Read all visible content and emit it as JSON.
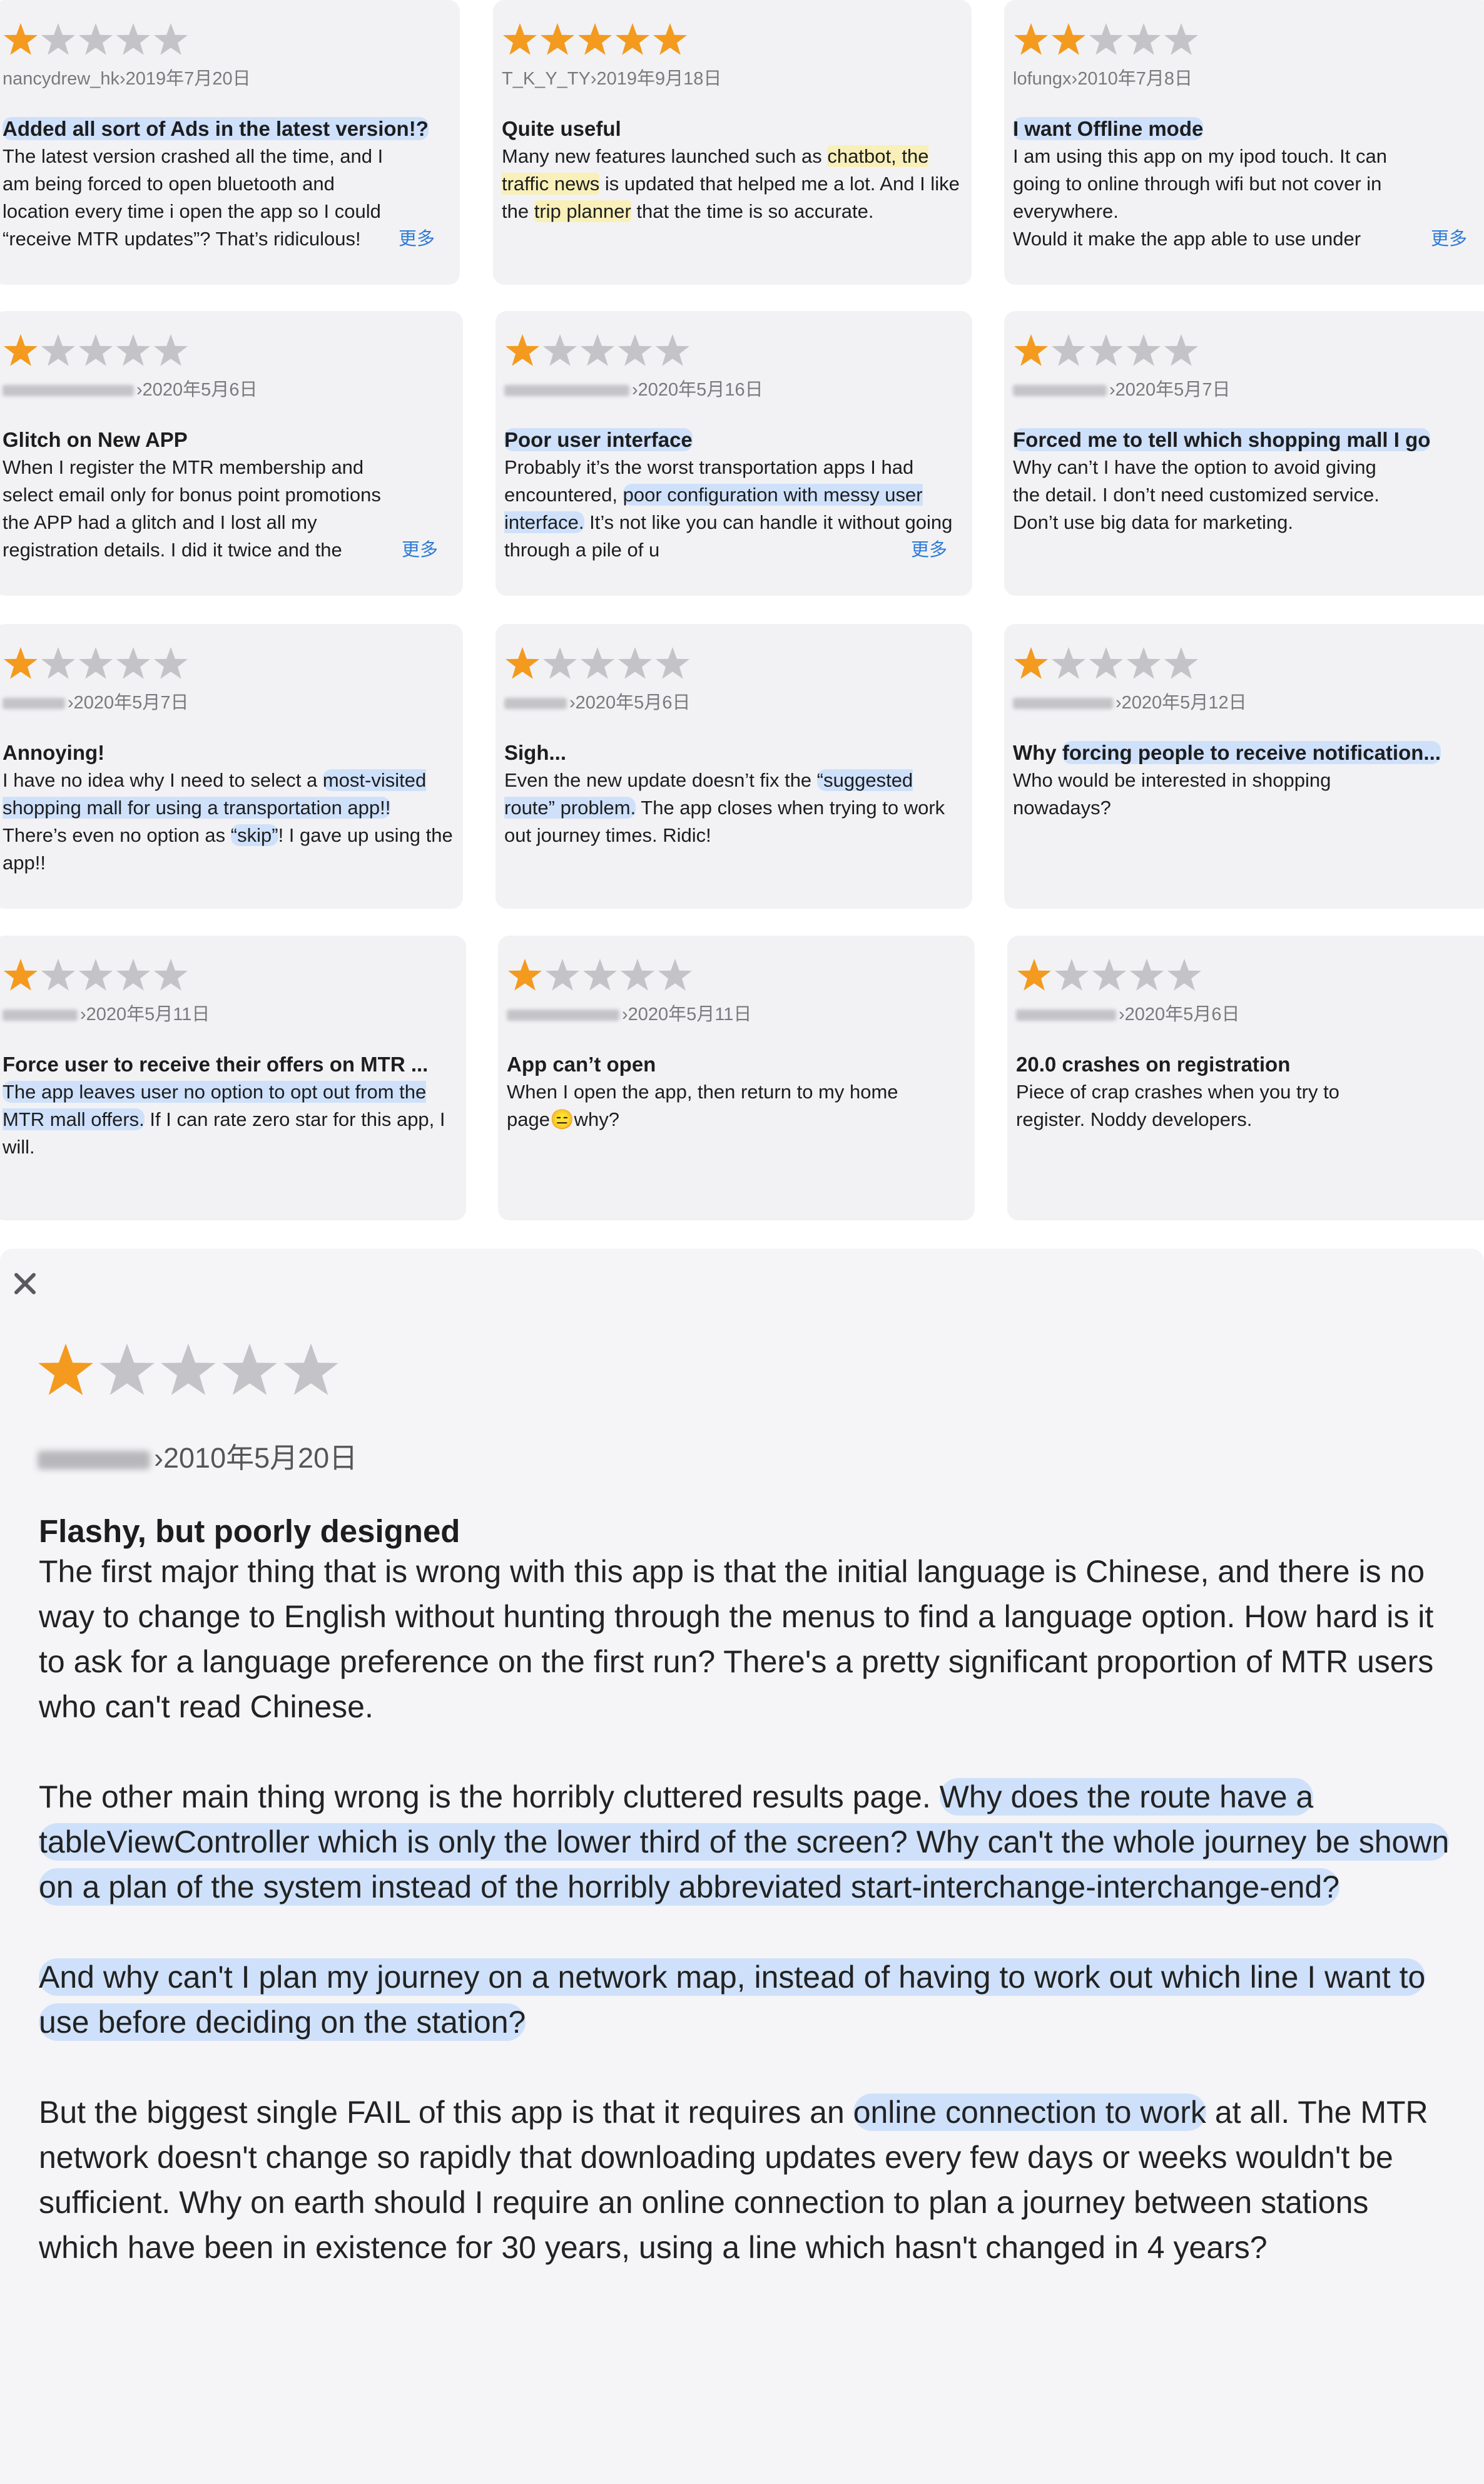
{
  "colors": {
    "star_filled": "#f39a1f",
    "star_empty": "#c4c4c8",
    "more_link": "#2f7bd6",
    "highlight_blue": "#cfe1fa",
    "highlight_yellow": "#f8f0b8"
  },
  "more_label": "更多",
  "reviews": [
    {
      "rating": 1,
      "author": "nancydrew_hk",
      "date": "2019年7月20日",
      "title": "Added all sort of Ads in the latest version!?",
      "body_lines": [
        "The latest version crashed all the time, and I",
        "am being forced to open bluetooth and",
        "location every time i open the app so I could",
        "“receive MTR updates”? That’s ridiculous!"
      ]
    },
    {
      "rating": 5,
      "author": "T_K_Y_TY",
      "date": "2019年9月18日",
      "title": "Quite useful",
      "body_parts": [
        "Many new features launched such as ",
        "chatbot, the traffic news",
        " is updated that helped me a lot. And I like the ",
        "trip planner",
        " that the time is so accurate."
      ]
    },
    {
      "rating": 2,
      "author": "lofungx",
      "date": "2010年7月8日",
      "title": "I want Offline mode",
      "body_lines": [
        "I am using this app on my ipod touch. It can",
        "going to online through wifi but not cover in",
        "everywhere.",
        "Would it make the app able to use under"
      ]
    },
    {
      "rating": 1,
      "author": "",
      "date": "2020年5月6日",
      "title": "Glitch on New APP",
      "body_lines": [
        "When I register the MTR membership and",
        "select email only for bonus point promotions",
        "the APP had a glitch and I lost all my",
        "registration details. I did it twice and the"
      ]
    },
    {
      "rating": 1,
      "author": "",
      "date": "2020年5月16日",
      "title": "Poor user interface",
      "body_parts": [
        "Probably it’s the worst transportation apps I had encountered, ",
        "poor configuration with messy user interface.",
        " It’s not like you can handle it without going through a pile of u"
      ]
    },
    {
      "rating": 1,
      "author": "",
      "date": "2020年5月7日",
      "title": "Forced me to tell which shopping mall I go",
      "body_lines": [
        "Why can’t I have the option to avoid giving",
        "the detail. I don’t need customized service.",
        "Don’t use big data for marketing."
      ]
    },
    {
      "rating": 1,
      "author": "",
      "date": "2020年5月7日",
      "title": "Annoying!",
      "body_parts": [
        "I have no idea why I need to select a ",
        "most-visited shopping mall for using a transportation app!!",
        " There’s even no option as ",
        "“skip”",
        "! I gave up using the app!!"
      ]
    },
    {
      "rating": 1,
      "author": "",
      "date": "2020年5月6日",
      "title": "Sigh...",
      "body_parts": [
        "Even the new update doesn’t fix the ",
        "“suggested route” problem.",
        " The app closes when trying to work out journey times. Ridic!"
      ]
    },
    {
      "rating": 1,
      "author": "",
      "date": "2020年5月12日",
      "title_parts": [
        "Why ",
        "forcing people to receive notification..."
      ],
      "body_lines": [
        "Who would be interested in shopping",
        "nowadays?"
      ]
    },
    {
      "rating": 1,
      "author": "",
      "date": "2020年5月11日",
      "title": "Force user to receive their offers on MTR ...",
      "body_parts": [
        "The app leaves user no option to opt out from the MTR mall offers.",
        " If I can rate zero star for this app, I will."
      ]
    },
    {
      "rating": 1,
      "author": "",
      "date": "2020年5月11日",
      "title": "App can’t open",
      "body_lines": [
        "When I open the app, then return to my home",
        "page😑why?"
      ]
    },
    {
      "rating": 1,
      "author": "",
      "date": "2020年5月6日",
      "title": "20.0 crashes on registration",
      "body_lines": [
        "Piece of crap crashes when you try to",
        "register. Noddy developers."
      ]
    }
  ],
  "detail": {
    "rating": 1,
    "author": "",
    "date": "2010年5月20日",
    "title": "Flashy, but poorly designed",
    "para1": "The first major thing that is wrong with this app is that the initial language is Chinese, and there is no way to change to English without hunting through the menus to find a language option. How hard is it to ask for a language preference on the first run? There's a pretty significant proportion of MTR users who can't read Chinese.",
    "para2_a": "The other main thing wrong is the horribly cluttered results page. ",
    "para2_b": "Why does the route have a tableViewController which is only the lower third of the screen? Why can't the whole journey be shown on a plan of the system instead of the horribly abbreviated start-interchange-interchange-end?",
    "para3": "And why can't I plan my journey on a network map, instead of having to work out which line I want to use before deciding on the station?",
    "para4_a": "But the biggest single FAIL of this app is that it requires an ",
    "para4_b": "online connection to work",
    "para4_c": " at all. The MTR network doesn't change so rapidly that downloading updates every few days or weeks wouldn't be sufficient. Why on earth should I require an online connection to plan a journey between stations which have been in existence for 30 years, using a line which hasn't changed in 4 years?"
  }
}
